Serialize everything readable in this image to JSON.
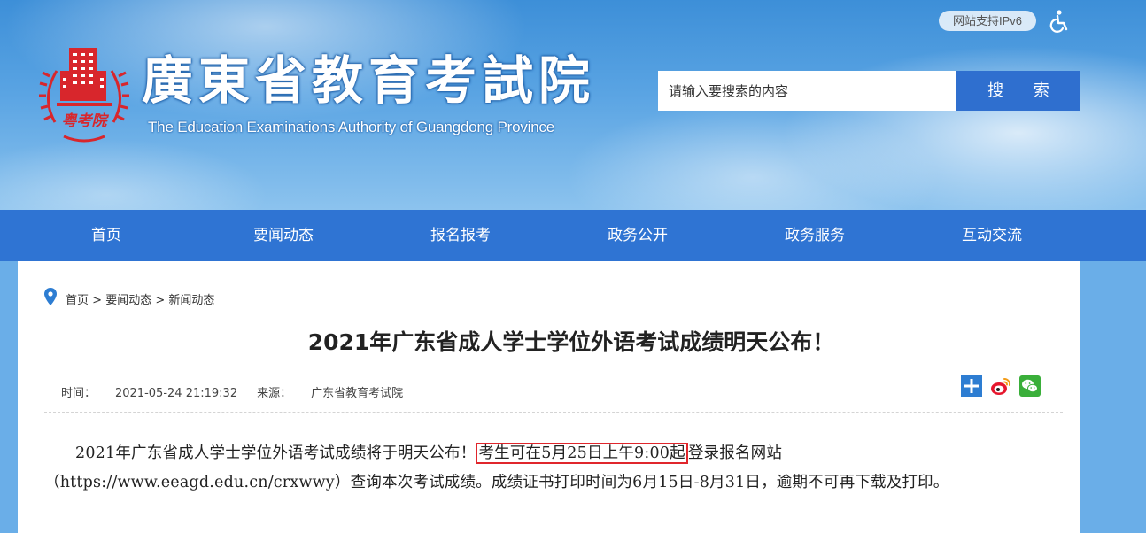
{
  "header": {
    "ipv6_badge": "网站支持IPv6",
    "title": "廣東省教育考試院",
    "subtitle": "The Education Examinations Authority of Guangdong Province",
    "logo_text": "粤考院"
  },
  "search": {
    "placeholder": "请输入要搜索的内容",
    "button_label": "搜 索"
  },
  "nav": {
    "items": [
      "首页",
      "要闻动态",
      "报名报考",
      "政务公开",
      "政务服务",
      "互动交流"
    ]
  },
  "breadcrumb": {
    "items": [
      "首页",
      "要闻动态",
      "新闻动态"
    ],
    "separator": ">"
  },
  "article": {
    "title": "2021年广东省成人学士学位外语考试成绩明天公布！",
    "time_label": "时间：",
    "time_value": "2021-05-24 21:19:32",
    "source_label": "来源：",
    "source_value": "广东省教育考试院",
    "body_part1": "2021年广东省成人学士学位外语考试成绩将于明天公布！",
    "body_highlight": "考生可在5月25日上午9:00起",
    "body_part2": "登录报名网站（https://www.eeagd.edu.cn/crxwwy）查询本次考试成绩。成绩证书打印时间为6月15日-8月31日，逾期不可再下载及打印。"
  },
  "colors": {
    "nav_bg": "#2f74d3",
    "search_button": "#2f6fcf",
    "highlight_border": "#e0262c",
    "logo_red": "#d8262c",
    "weibo_red": "#e6162d",
    "wechat_green": "#3aaf3a",
    "share_blue": "#2d7dd2"
  },
  "icons": {
    "accessibility": "accessibility-icon",
    "location": "location-pin-icon",
    "share_plus": "share-plus-icon",
    "weibo": "weibo-icon",
    "wechat": "wechat-icon"
  }
}
